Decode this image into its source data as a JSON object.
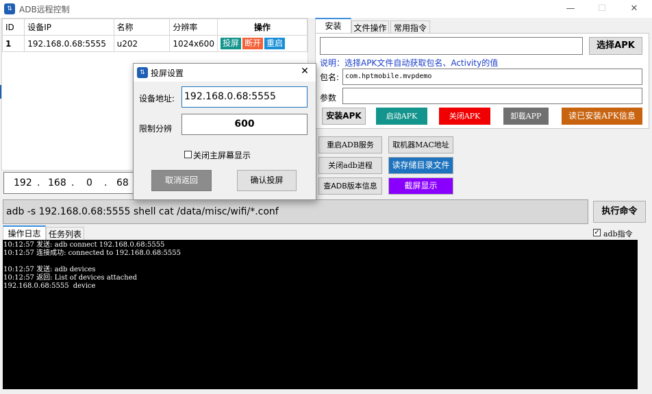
{
  "window": {
    "title": "ADB远程控制",
    "minimize": "—",
    "maximize": "☐",
    "close": "✕"
  },
  "device_table": {
    "headers": [
      "ID",
      "设备IP",
      "名称",
      "分辨率",
      "操作"
    ],
    "rows": [
      {
        "id": "1",
        "ip": "192.168.0.68:5555",
        "name": "u202",
        "resolution": "1024x600",
        "actions": [
          {
            "label": "投屏",
            "color": "#13948c"
          },
          {
            "label": "断开",
            "color": "#f4623a"
          },
          {
            "label": "重启",
            "color": "#1a8fd8"
          }
        ]
      }
    ]
  },
  "ip_fields": [
    "192",
    "168",
    "0",
    "68"
  ],
  "ip_dots": [
    ".",
    ".",
    "."
  ],
  "tabs": [
    "安装",
    "文件操作",
    "常用指令"
  ],
  "install": {
    "apk_path": "",
    "select_apk": "选择APK",
    "note": "说明：选择APK文件自动获取包名、Activity的值",
    "package_label": "包名:",
    "package_value": "com.hptmobile.mvpdemo",
    "params_label": "参数",
    "params_value": "",
    "buttons": [
      {
        "label": "安装APK",
        "color": "#e1e1e1"
      },
      {
        "label": "启动APK",
        "color": "#13948c"
      },
      {
        "label": "关闭APK",
        "color": "#f00000"
      },
      {
        "label": "卸载APP",
        "color": "#707070"
      },
      {
        "label": "读已安装APK信息",
        "color": "#c86410"
      }
    ]
  },
  "tools": {
    "restart_adb": "重启ADB服务",
    "get_mac": "取机器MAC地址",
    "kill_adb": "关闭adb进程",
    "read_storage": "读存储目录文件",
    "adb_version": "查ADB版本信息",
    "screenshot": "截屏显示",
    "read_storage_color": "#1e73be",
    "screenshot_color": "#8a00ff"
  },
  "command": {
    "value": "adb -s 192.168.0.68:5555 shell cat /data/misc/wifi/*.conf",
    "run": "执行命令"
  },
  "bottom_tabs": [
    "操作日志",
    "任务列表"
  ],
  "adb_checkbox": {
    "label": "adb指令",
    "checked": "✓"
  },
  "log": {
    "text": "10:12:57 发送: adb connect 192.168.0.68:5555\n10:12:57 连接成功: connected to 192.168.0.68:5555\n\n10:12:57 发送: adb devices\n10:12:57 返回: List of devices attached\n192.168.0.68:5555\tdevice"
  },
  "dialog": {
    "title": "投屏设置",
    "close": "✕",
    "address_label": "设备地址:",
    "address_value": "192.168.0.68:5555",
    "limit_label": "限制分辨",
    "limit_value": "600",
    "close_display_label": "关闭主屏幕显示",
    "cancel": "取消返回",
    "confirm": "确认投屏"
  }
}
